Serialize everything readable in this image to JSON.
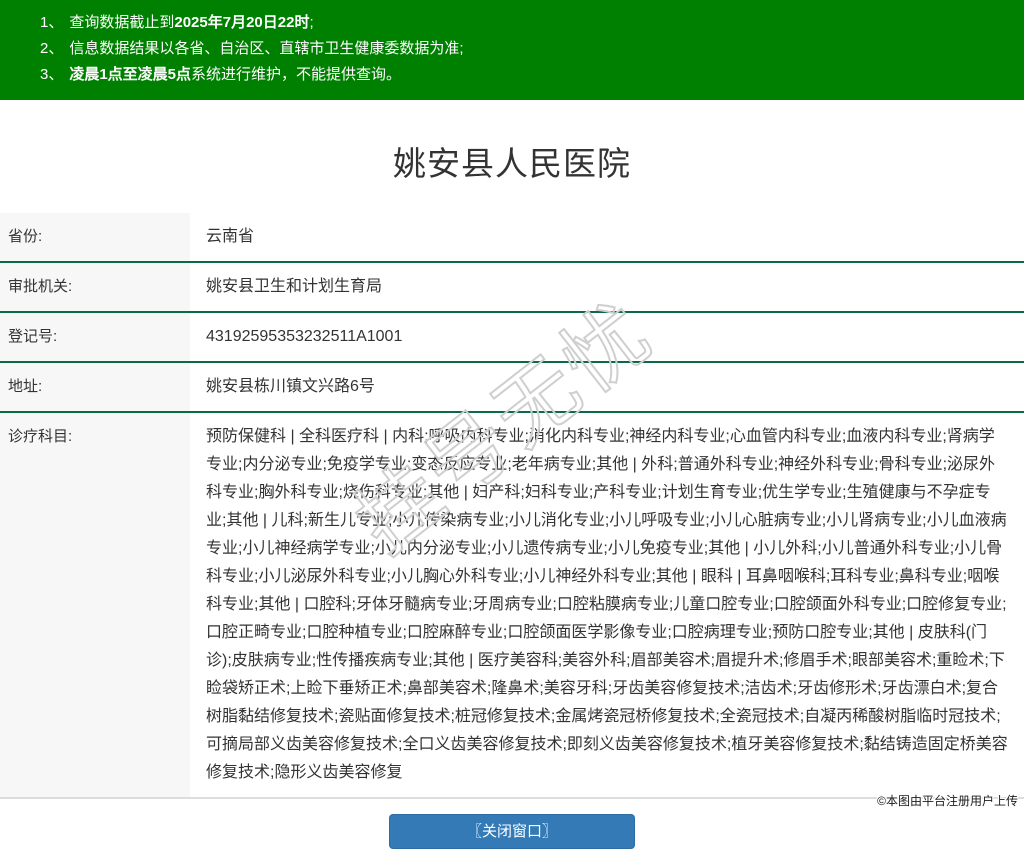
{
  "header": {
    "bg_color": "#008000",
    "notices": [
      {
        "num": "1、",
        "pre": "查询数据截止到",
        "bold": "2025年7月20日22时",
        "post": ";"
      },
      {
        "num": "2、",
        "pre": "信息数据结果以各省、自治区、直辖市卫生健康委数据为准;",
        "bold": "",
        "post": ""
      },
      {
        "num": "3、",
        "pre": "",
        "bold": "凌晨1点至凌晨5点",
        "post": "系统进行维护，不能提供查询。"
      }
    ]
  },
  "title": "姚安县人民医院",
  "info": {
    "rows": [
      {
        "label": "省份:",
        "value": "云南省"
      },
      {
        "label": "审批机关:",
        "value": "姚安县卫生和计划生育局"
      },
      {
        "label": "登记号:",
        "value": "43192595353232511A1001"
      },
      {
        "label": "地址:",
        "value": "姚安县栋川镇文兴路6号"
      },
      {
        "label": "诊疗科目:",
        "value": "预防保健科 | 全科医疗科 | 内科;呼吸内科专业;消化内科专业;神经内科专业;心血管内科专业;血液内科专业;肾病学专业;内分泌专业;免疫学专业;变态反应专业;老年病专业;其他 | 外科;普通外科专业;神经外科专业;骨科专业;泌尿外科专业;胸外科专业;烧伤科专业;其他 | 妇产科;妇科专业;产科专业;计划生育专业;优生学专业;生殖健康与不孕症专业;其他 | 儿科;新生儿专业;小儿传染病专业;小儿消化专业;小儿呼吸专业;小儿心脏病专业;小儿肾病专业;小儿血液病专业;小儿神经病学专业;小儿内分泌专业;小儿遗传病专业;小儿免疫专业;其他 | 小儿外科;小儿普通外科专业;小儿骨科专业;小儿泌尿外科专业;小儿胸心外科专业;小儿神经外科专业;其他 | 眼科 | 耳鼻咽喉科;耳科专业;鼻科专业;咽喉科专业;其他 | 口腔科;牙体牙髓病专业;牙周病专业;口腔粘膜病专业;儿童口腔专业;口腔颌面外科专业;口腔修复专业;口腔正畸专业;口腔种植专业;口腔麻醉专业;口腔颌面医学影像专业;口腔病理专业;预防口腔专业;其他 | 皮肤科(门诊);皮肤病专业;性传播疾病专业;其他 | 医疗美容科;美容外科;眉部美容术;眉提升术;修眉手术;眼部美容术;重睑术;下睑袋矫正术;上睑下垂矫正术;鼻部美容术;隆鼻术;美容牙科;牙齿美容修复技术;洁齿术;牙齿修形术;牙齿漂白术;复合树脂黏结修复技术;瓷贴面修复技术;桩冠修复技术;金属烤瓷冠桥修复技术;全瓷冠技术;自凝丙稀酸树脂临时冠技术;可摘局部义齿美容修复技术;全口义齿美容修复技术;即刻义齿美容修复技术;植牙美容修复技术;黏结铸造固定桥美容修复技术;隐形义齿美容修复"
      }
    ]
  },
  "close_button": {
    "label": "〖关闭窗口〗",
    "bg_color": "#337ab7"
  },
  "watermark": {
    "text": "挂号无忧"
  },
  "footer": {
    "copyright": "©本图由平台注册用户上传"
  },
  "colors": {
    "banner_green": "#008000",
    "row_divider_green": "#0a6a43",
    "label_cell_bg": "#f7f7f7",
    "button_blue": "#337ab7"
  }
}
